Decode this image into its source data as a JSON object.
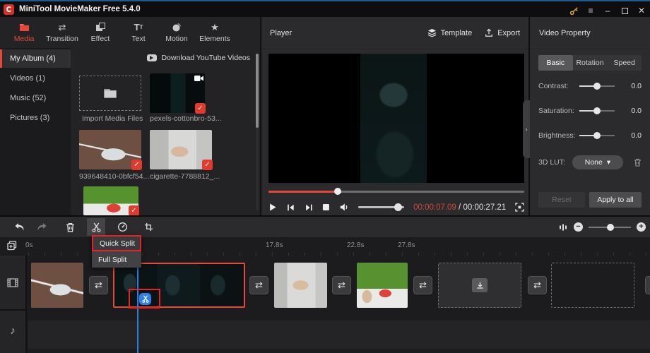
{
  "title_bar": {
    "title": "MiniTool MovieMaker Free 5.4.0"
  },
  "nav": {
    "tabs": [
      {
        "label": "Media",
        "active": true
      },
      {
        "label": "Transition",
        "active": false
      },
      {
        "label": "Effect",
        "active": false
      },
      {
        "label": "Text",
        "active": false
      },
      {
        "label": "Motion",
        "active": false
      },
      {
        "label": "Elements",
        "active": false
      }
    ]
  },
  "sidebar": {
    "items": [
      {
        "label": "My Album (4)",
        "active": true
      },
      {
        "label": "Videos (1)",
        "active": false
      },
      {
        "label": "Music (52)",
        "active": false
      },
      {
        "label": "Pictures (3)",
        "active": false
      }
    ]
  },
  "media": {
    "download_link": "Download YouTube Videos",
    "import_label": "Import Media Files",
    "items": [
      {
        "name": "pexels-cottonbro-53...",
        "type": "video",
        "selected": true
      },
      {
        "name": "939648410-0bfcf54...",
        "type": "video",
        "selected": true
      },
      {
        "name": "cigarette-7788812_...",
        "type": "image",
        "selected": true
      }
    ]
  },
  "player": {
    "title": "Player",
    "template_label": "Template",
    "export_label": "Export",
    "current_time": "00:00:07.09",
    "time_separator": " / ",
    "total_time": "00:00:27.21",
    "progress_percent": 27
  },
  "props": {
    "title": "Video Property",
    "tabs": [
      {
        "label": "Basic",
        "active": true
      },
      {
        "label": "Rotation",
        "active": false
      },
      {
        "label": "Speed",
        "active": false
      }
    ],
    "sliders": [
      {
        "label": "Contrast:",
        "value": "0.0"
      },
      {
        "label": "Saturation:",
        "value": "0.0"
      },
      {
        "label": "Brightness:",
        "value": "0.0"
      }
    ],
    "lut_label": "3D LUT:",
    "lut_value": "None",
    "reset_label": "Reset",
    "apply_label": "Apply to all"
  },
  "timeline": {
    "ruler_labels": [
      {
        "text": "0s"
      },
      {
        "text": "17.8s"
      },
      {
        "text": "22.8s"
      },
      {
        "text": "27.8s"
      }
    ],
    "split_menu": {
      "items": [
        {
          "label": "Quick Split",
          "highlighted": true
        },
        {
          "label": "Full Split",
          "highlighted": false
        }
      ]
    }
  },
  "colors": {
    "accent_red": "#e6493a",
    "selection_red": "#e62222",
    "badge_blue": "#2f80ed",
    "playhead_blue": "#2a7de1",
    "current_time_red": "#cd4a35",
    "key_gold": "#d9a716"
  },
  "icons": {
    "menu": "≡",
    "minimize": "–",
    "close": "✕",
    "check": "✓",
    "transition": "⇄",
    "music_note": "♪",
    "star": "★",
    "chevron_down": "▾",
    "chevron_right": "›",
    "minus": "−",
    "plus": "+"
  }
}
